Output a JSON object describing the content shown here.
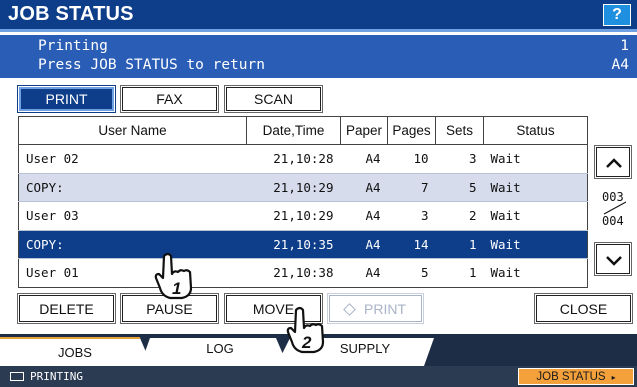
{
  "header": {
    "title": "JOB STATUS",
    "help_label": "?"
  },
  "message": {
    "line1": "Printing",
    "line2": "Press JOB STATUS to return",
    "right1": "1",
    "right2": "A4"
  },
  "job_type_tabs": {
    "print": "PRINT",
    "fax": "FAX",
    "scan": "SCAN",
    "active": "print"
  },
  "table": {
    "headers": {
      "user": "User Name",
      "date": "Date,Time",
      "paper": "Paper",
      "pages": "Pages",
      "sets": "Sets",
      "status": "Status"
    },
    "rows": [
      {
        "user": "User 02",
        "date": "21,10:28",
        "paper": "A4",
        "pages": "10",
        "sets": "3",
        "status": "Wait"
      },
      {
        "user": "COPY:",
        "date": "21,10:29",
        "paper": "A4",
        "pages": "7",
        "sets": "5",
        "status": "Wait"
      },
      {
        "user": "User 03",
        "date": "21,10:29",
        "paper": "A4",
        "pages": "3",
        "sets": "2",
        "status": "Wait"
      },
      {
        "user": "COPY:",
        "date": "21,10:35",
        "paper": "A4",
        "pages": "14",
        "sets": "1",
        "status": "Wait"
      },
      {
        "user": "User 01",
        "date": "21,10:38",
        "paper": "A4",
        "pages": "5",
        "sets": "1",
        "status": "Wait"
      }
    ],
    "selected_row": 3
  },
  "pager": {
    "current": "003",
    "total": "004"
  },
  "actions": {
    "delete": "DELETE",
    "pause": "PAUSE",
    "move": "MOVE",
    "print": "PRINT",
    "close": "CLOSE"
  },
  "bottom_tabs": {
    "jobs": "JOBS",
    "log": "LOG",
    "supply": "SUPPLY"
  },
  "status_bar": {
    "status": "PRINTING",
    "job_status_button": "JOB STATUS"
  },
  "callouts": {
    "first": "1",
    "second": "2"
  },
  "colors": {
    "title_bg": "#0e3d8a",
    "message_bg": "#2a5db5",
    "selected_row": "#0e3d8a",
    "accent_orange": "#f4a13c"
  }
}
